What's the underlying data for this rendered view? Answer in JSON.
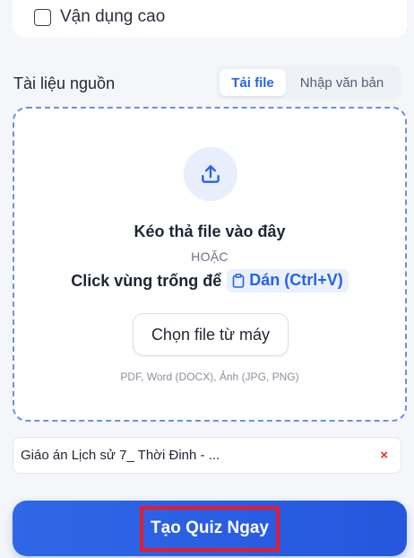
{
  "options": {
    "advanced_label": "Vận dụng cao"
  },
  "source": {
    "title": "Tài liệu nguồn",
    "tabs": [
      {
        "label": "Tải file"
      },
      {
        "label": "Nhập văn bản"
      }
    ]
  },
  "dropzone": {
    "title": "Kéo thả file vào đây",
    "or_text": "HOẶC",
    "click_text": "Click vùng trống để",
    "paste_label": "Dán (Ctrl+V)",
    "choose_button": "Chọn file từ máy",
    "formats": "PDF, Word (DOCX), Ảnh (JPG, PNG)"
  },
  "file": {
    "name": "Giáo án Lịch sử 7_ Thời Đinh - ...",
    "remove_symbol": "×"
  },
  "actions": {
    "create_label": "Tạo Quiz Ngay"
  },
  "colors": {
    "accent": "#2563eb",
    "dropzone_border": "#6d8fe3",
    "remove": "#d9352b",
    "highlight": "#e51b2f"
  }
}
